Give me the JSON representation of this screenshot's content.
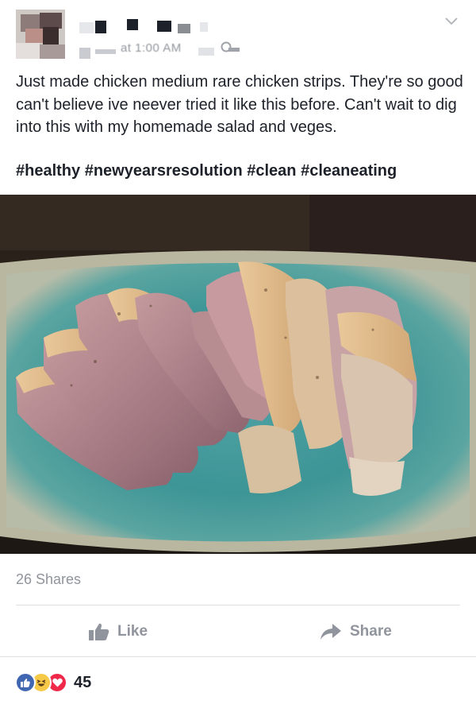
{
  "post": {
    "timestamp": "at 1:00 AM",
    "caption": "Just made chicken medium rare chicken strips. They're so good can't believe ive neever tried it like this before. Can't wait to dig into this with my homemade salad and veges.",
    "hashtags": [
      "#healthy",
      "#newyearsresolution",
      "#clean",
      "#cleaneating"
    ],
    "photo_icon": "chicken-sashimi-photo"
  },
  "stats": {
    "shares": "26 Shares",
    "reaction_count": "45",
    "reactions": [
      "like",
      "haha",
      "love"
    ]
  },
  "actions": {
    "like_label": "Like",
    "share_label": "Share"
  },
  "colors": {
    "muted_text": "#90949c",
    "like_blue": "#4267b2",
    "love_red": "#f0284a",
    "haha_yellow": "#f7c948",
    "divider": "#dddfe2"
  },
  "icons": {
    "chevron": "chevron-down-icon",
    "privacy": "globe-icon",
    "like": "thumbs-up-icon",
    "share": "share-arrow-icon"
  }
}
